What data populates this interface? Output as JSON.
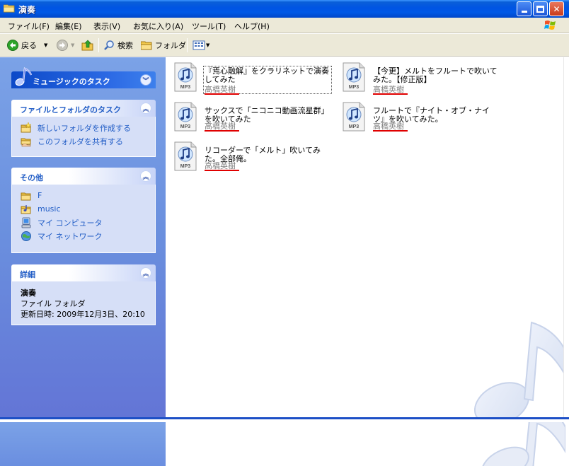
{
  "window": {
    "title": "演奏"
  },
  "menu": [
    "ファイル(F)",
    "編集(E)",
    "表示(V)",
    "お気に入り(A)",
    "ツール(T)",
    "ヘルプ(H)"
  ],
  "toolbar": {
    "back": "戻る",
    "search": "検索",
    "folders": "フォルダ"
  },
  "music_tasks": {
    "title": "ミュージックのタスク"
  },
  "file_folder_tasks": {
    "title": "ファイルとフォルダのタスク",
    "items": [
      "新しいフォルダを作成する",
      "このフォルダを共有する"
    ]
  },
  "other_places": {
    "title": "その他",
    "items": [
      "F",
      "music",
      "マイ コンピュータ",
      "マイ ネットワーク"
    ]
  },
  "details": {
    "title": "詳細",
    "name": "演奏",
    "type": "ファイル フォルダ",
    "modified": "更新日時: 2009年12月3日、20:10"
  },
  "files": [
    {
      "name": "『焉心融解』をクラリネットで演奏してみた",
      "artist": "高橋英樹",
      "selected": true
    },
    {
      "name": "【今更】メルトをフルートで吹いてみた。【修正版】",
      "artist": "高橋英樹",
      "selected": false
    },
    {
      "name": "サックスで「ニコニコ動画流星群」を吹いてみた",
      "artist": "高橋英樹",
      "selected": false
    },
    {
      "name": "フルートで『ナイト・オブ・ナイツ』を吹いてみた。",
      "artist": "高橋英樹",
      "selected": false
    },
    {
      "name": "リコーダーで「メルト」吹いてみた。全部俺。",
      "artist": "高橋英樹",
      "selected": false
    }
  ],
  "icon_label": "MP3",
  "colors": {
    "titlebar": "#0054e3",
    "link": "#215dc6",
    "annotation": "#e00000"
  }
}
